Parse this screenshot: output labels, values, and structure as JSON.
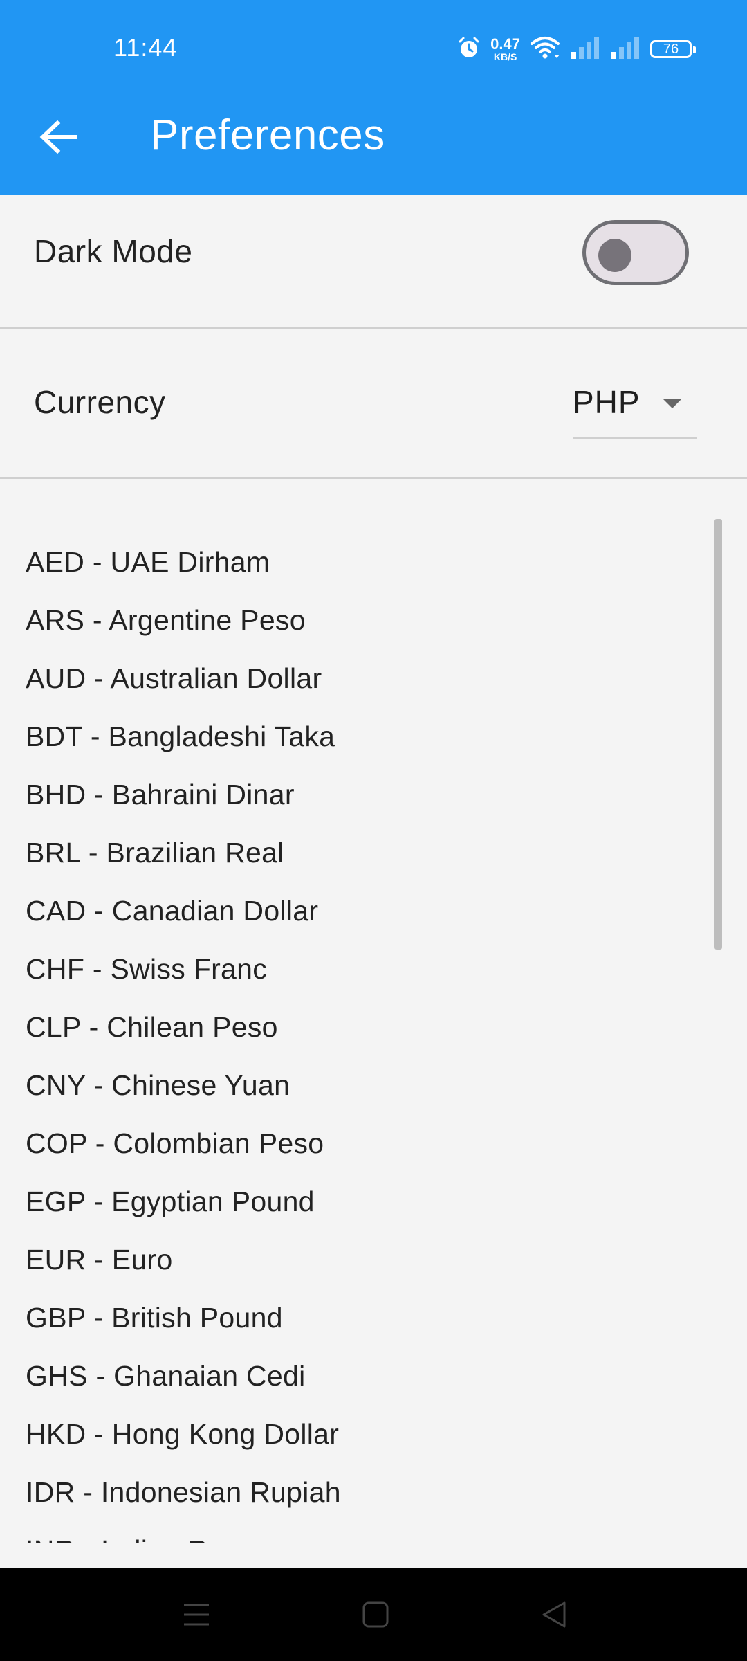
{
  "status_bar": {
    "time": "11:44",
    "net_speed_value": "0.47",
    "net_speed_unit": "KB/S",
    "battery": "76",
    "icons": [
      "alarm-icon",
      "wifi-icon",
      "signal-icon",
      "signal-icon"
    ]
  },
  "app_bar": {
    "back_icon": "arrow-left-icon",
    "title": "Preferences",
    "color": "#2196f3"
  },
  "settings": {
    "dark_mode": {
      "label": "Dark Mode",
      "enabled": false
    },
    "currency": {
      "label": "Currency",
      "selected": "PHP"
    }
  },
  "currency_options": [
    "AED - UAE Dirham",
    "ARS - Argentine Peso",
    "AUD - Australian Dollar",
    "BDT - Bangladeshi Taka",
    "BHD - Bahraini Dinar",
    "BRL - Brazilian Real",
    "CAD - Canadian Dollar",
    "CHF - Swiss Franc",
    "CLP - Chilean Peso",
    "CNY - Chinese Yuan",
    "COP - Colombian Peso",
    "EGP - Egyptian Pound",
    "EUR - Euro",
    "GBP - British Pound",
    "GHS - Ghanaian Cedi",
    "HKD - Hong Kong Dollar",
    "IDR - Indonesian Rupiah",
    "INR - Indian Rupee"
  ],
  "nav_bar": {
    "icons": [
      "menu-icon",
      "home-icon",
      "back-icon"
    ]
  }
}
